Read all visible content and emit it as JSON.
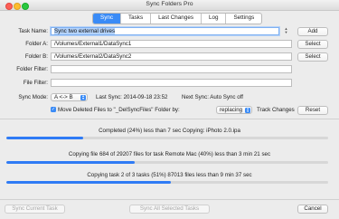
{
  "window": {
    "title": "Sync Folders Pro"
  },
  "tabs": [
    {
      "label": "Sync",
      "active": true
    },
    {
      "label": "Tasks",
      "active": false
    },
    {
      "label": "Last Changes",
      "active": false
    },
    {
      "label": "Log",
      "active": false
    },
    {
      "label": "Settings",
      "active": false
    }
  ],
  "form": {
    "task_name": {
      "label": "Task Name:",
      "value": "Sync two external drives"
    },
    "folder_a": {
      "label": "Folder A:",
      "value": "/Volumes/External1/DataSync1",
      "button": "Select"
    },
    "folder_b": {
      "label": "Folder B:",
      "value": "/Volumes/External2/DataSync2",
      "button": "Select"
    },
    "folder_filter": {
      "label": "Folder Filter:",
      "value": ""
    },
    "file_filter": {
      "label": "File Filter:",
      "value": ""
    },
    "add_button": "Add"
  },
  "sync": {
    "mode_label": "Sync Mode:",
    "mode_value": "A <-> B",
    "last_sync": "Last Sync: 2014-09-18 23:52",
    "next_sync": "Next Sync: Auto Sync off",
    "move_deleted_label": "Move Deleted Files to \"_DelSyncFiles\" Folder by:",
    "move_deleted_checked": true,
    "replace_mode": "replacing",
    "track_changes_label": "Track Changes",
    "reset_button": "Reset"
  },
  "progress": [
    {
      "text": "Completed (24%) less than 7 sec Copying: iPhoto 2.0.ipa",
      "fraction": 0.24
    },
    {
      "text": "Copying file 684 of 29207 files for task Remote Mac (40%) less than 3 min 21 sec",
      "fraction": 0.4
    },
    {
      "text": "Copying task 2 of 3 tasks (51%) 87013 files less than 9 min 37 sec",
      "fraction": 0.51
    }
  ],
  "footer": {
    "sync_current": "Sync Current Task",
    "sync_all": "Sync All Selected Tasks",
    "cancel": "Cancel"
  },
  "colors": {
    "accent": "#3a8bf6",
    "progress": "#2f7bf5"
  }
}
